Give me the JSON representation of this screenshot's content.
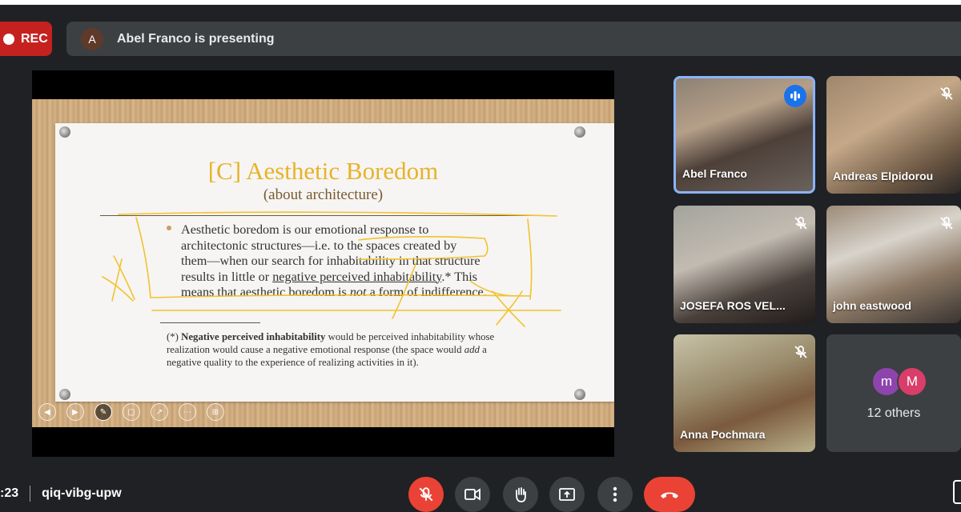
{
  "recording": {
    "label": "REC"
  },
  "presenting_bar": {
    "avatar_letter": "A",
    "text": "Abel Franco is presenting"
  },
  "slide": {
    "title": "[C] Aesthetic Boredom",
    "subtitle": "(about architecture)",
    "bullet": {
      "line1": "Aesthetic boredom is our emotional response to",
      "line2a": "architectonic structures—i.e. to the spaces created by",
      "line3": "them—when our search for inhabitability in that structure",
      "line4a": "results in little or ",
      "line4u": "negative perceived inhabitability",
      "line4b": ".* This",
      "line5a": "means that aesthetic boredom is ",
      "line5i": "not",
      "line5b": " a form of indifference."
    },
    "footnote": {
      "prefix": "(*) ",
      "bold": "Negative perceived inhabitability",
      "rest1": " would be perceived inhabitability whose realization would cause a negative emotional response (the space would ",
      "italic": "add",
      "rest2": " a negative quality to the experience of realizing activities in it)."
    }
  },
  "slide_controls": [
    "previous-slide",
    "next-slide",
    "pen-tool",
    "slide-overview",
    "pointer-tool",
    "more-options",
    "zoom-tool"
  ],
  "participants": [
    {
      "name": "Abel Franco",
      "speaking": true
    },
    {
      "name": "Andreas Elpidorou",
      "muted": true
    },
    {
      "name": "JOSEFA ROS VEL...",
      "muted": true
    },
    {
      "name": "john eastwood",
      "muted": true
    },
    {
      "name": "Anna Pochmara",
      "muted": true
    }
  ],
  "others": {
    "avatars": [
      "m",
      "M"
    ],
    "avatar_colors": [
      "#8e44ad",
      "#d93d6a"
    ],
    "label": "12 others"
  },
  "footer": {
    "clock": ":23",
    "meeting_code": "qiq-vibg-upw"
  },
  "controls": {
    "mic": "mic-off-icon",
    "camera": "camera-icon",
    "hand": "raise-hand-icon",
    "present": "present-now-icon",
    "more": "more-options-icon",
    "end": "end-call-icon"
  },
  "colors": {
    "accent_blue": "#1a73e8",
    "danger_red": "#ea4335",
    "rec_red": "#c5221f",
    "slide_title": "#e8b22a",
    "ink_yellow": "#f2c230"
  }
}
